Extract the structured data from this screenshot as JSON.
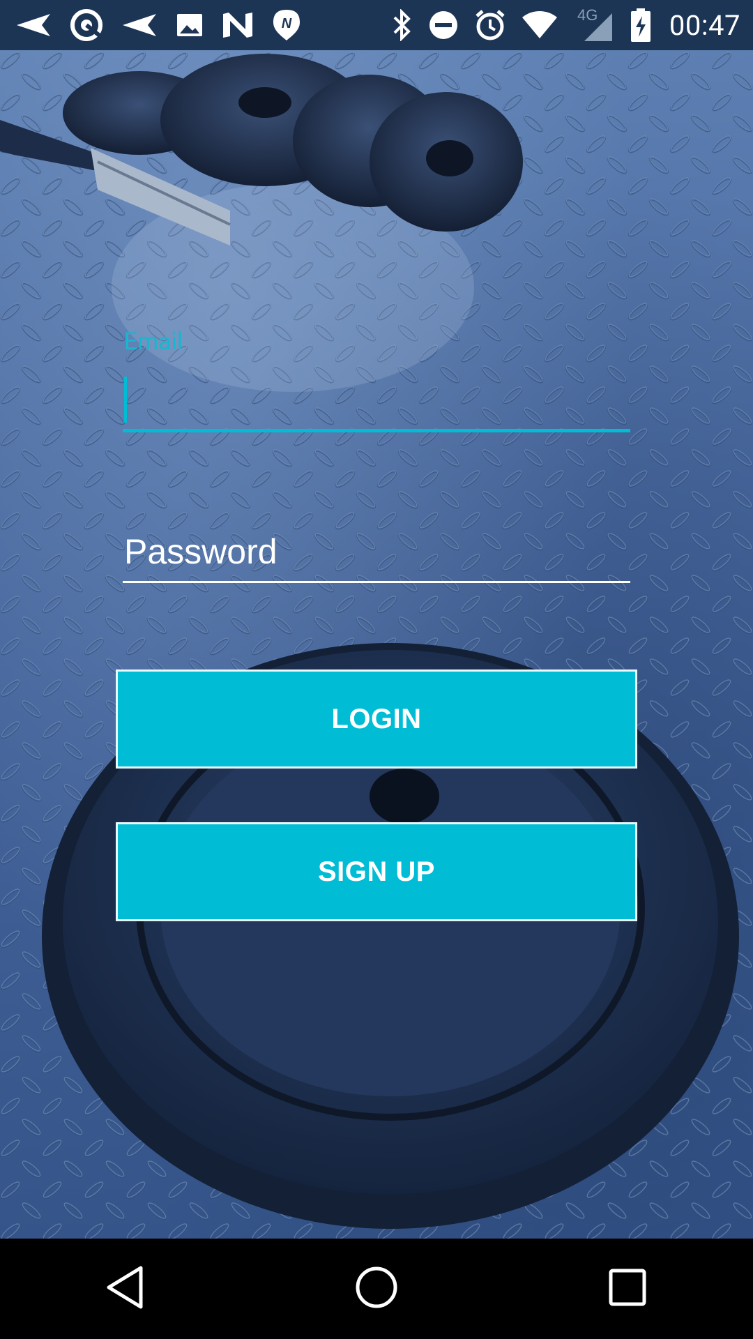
{
  "status_bar": {
    "time": "00:47",
    "network": "4G",
    "icons": [
      "send-icon",
      "sync-icon",
      "send-icon",
      "image-icon",
      "n-app-icon",
      "nfc-icon",
      "bluetooth-icon",
      "do-not-disturb-icon",
      "alarm-icon",
      "wifi-icon",
      "cellular-signal-icon",
      "battery-charging-icon"
    ]
  },
  "form": {
    "email_label": "Email",
    "email_value": "",
    "password_placeholder": "Password",
    "password_value": ""
  },
  "buttons": {
    "login": "LOGIN",
    "signup": "SIGN UP"
  },
  "nav": {
    "icons": [
      "back-icon",
      "home-icon",
      "recents-icon"
    ]
  },
  "colors": {
    "accent": "#00bcd4",
    "status_bar": "#1c3554",
    "background": "#4a6aa0"
  }
}
